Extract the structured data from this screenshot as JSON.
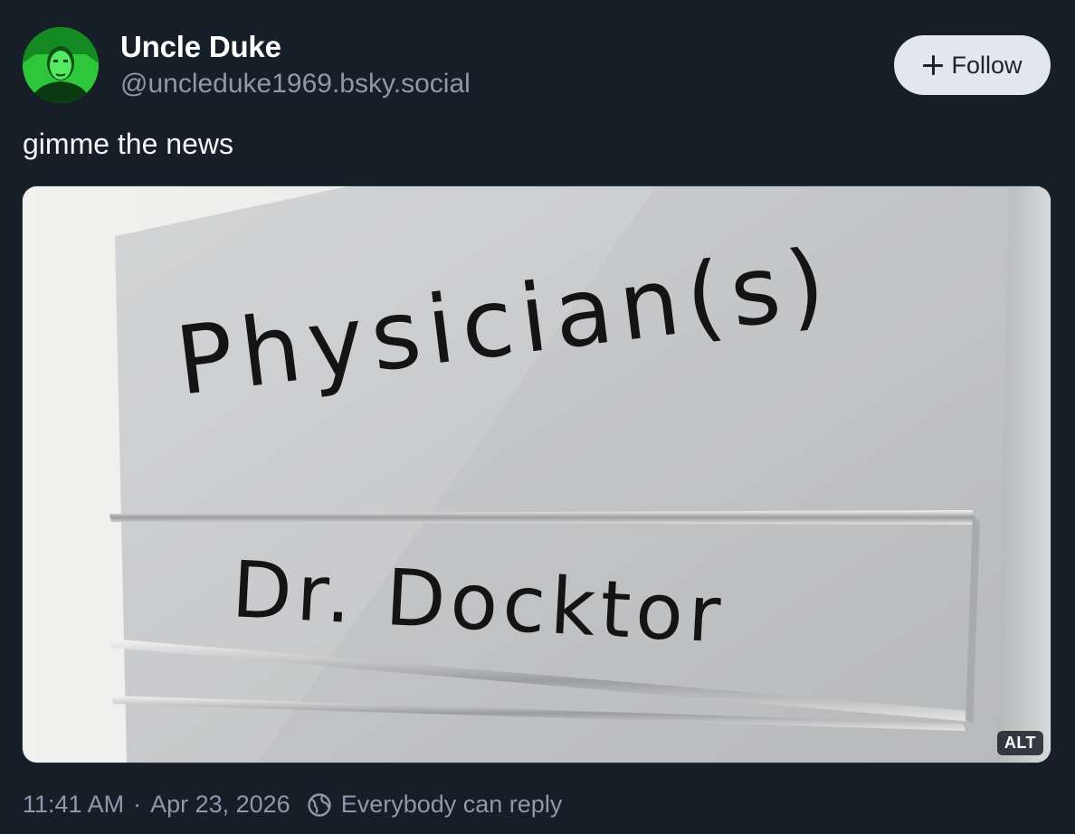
{
  "author": {
    "display_name": "Uncle Duke",
    "handle": "@uncleduke1969.bsky.social"
  },
  "follow_button": {
    "label": "Follow",
    "icon": "plus-icon"
  },
  "post": {
    "text": "gimme the news",
    "image": {
      "sign_text_top": "Physician(s)",
      "sign_text_bottom": "Dr. Docktor",
      "alt_badge": "ALT"
    }
  },
  "meta": {
    "time": "11:41 AM",
    "separator": "·",
    "date": "Apr 23, 2026",
    "reply_icon": "globe-icon",
    "reply_setting": "Everybody can reply"
  },
  "colors": {
    "background": "#161e27",
    "muted_text": "#8d9aab",
    "follow_bg": "#e2e7ee"
  }
}
